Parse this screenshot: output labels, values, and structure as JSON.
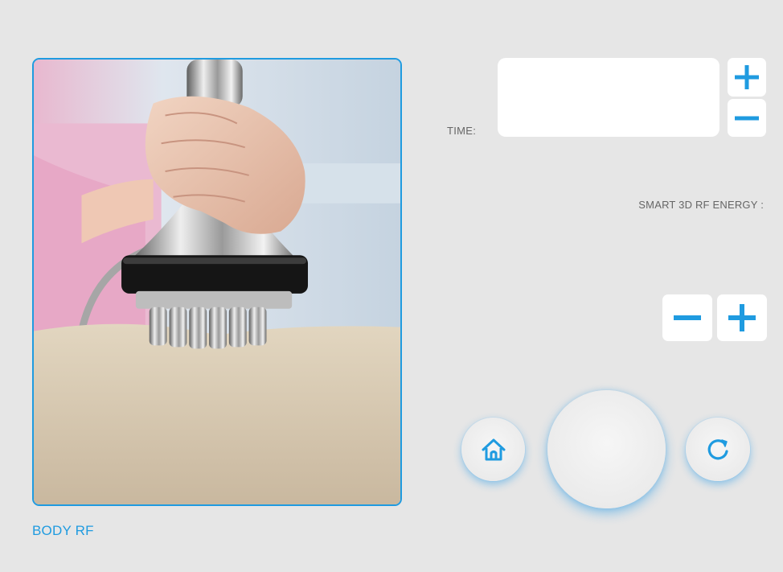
{
  "mode": {
    "label": "BODY RF",
    "image_subject": "Hand holding RF handpiece on body skin"
  },
  "time": {
    "label": "TIME:",
    "value": "",
    "plus_icon": "plus-icon",
    "minus_icon": "minus-icon"
  },
  "energy": {
    "label": "SMART 3D RF ENERGY :",
    "value": "",
    "plus_icon": "plus-icon",
    "minus_icon": "minus-icon"
  },
  "controls": {
    "home_icon": "home-icon",
    "refresh_icon": "refresh-icon",
    "start_label": ""
  },
  "colors": {
    "accent": "#1f9be0",
    "background": "#e6e6e6",
    "panel": "#ffffff",
    "label_text": "#666666"
  }
}
